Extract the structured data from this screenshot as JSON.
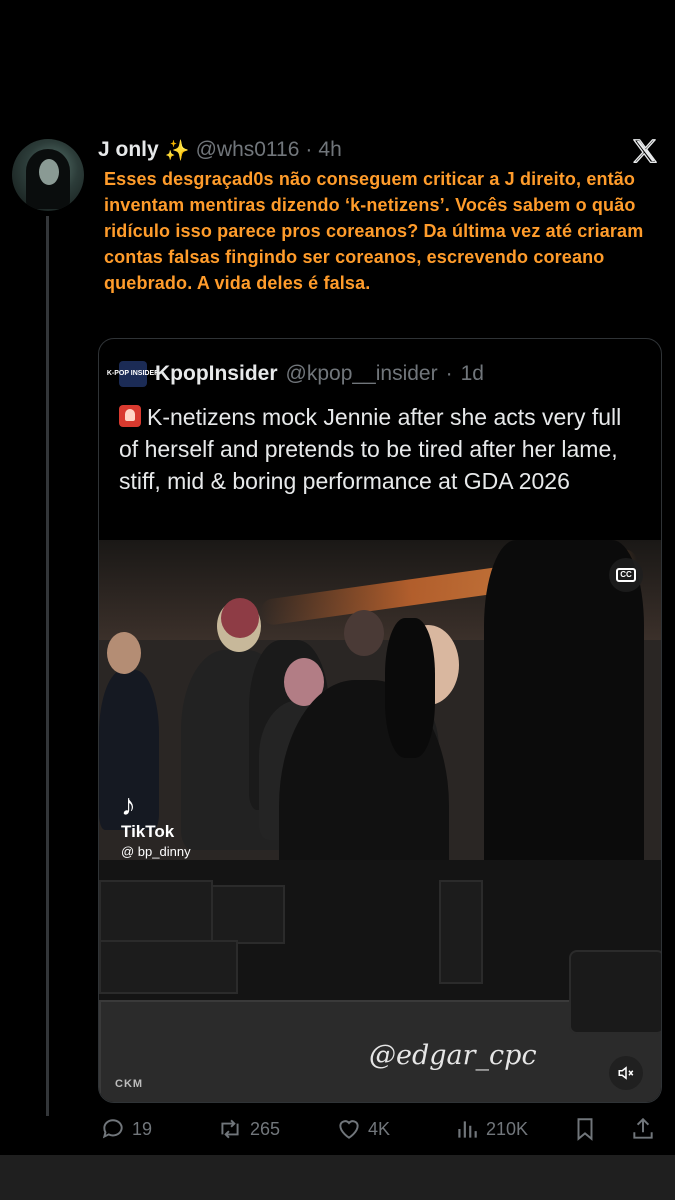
{
  "tweet": {
    "author_name": "J only",
    "author_emoji": "✨",
    "handle": "@whs0116",
    "separator": "·",
    "time": "4h",
    "text": "Esses desgraçad0s não conseguem criticar a J direito, então inventam mentiras dizendo ‘k-netizens’. Vocês sabem o quão ridículo isso parece pros coreanos? Da última vez até criaram contas falsas fingindo ser coreanos, escrevendo coreano quebrado. A vida deles é falsa.",
    "text_color": "#ff9c2b"
  },
  "quote": {
    "logo_text": "K-POP INSIDER",
    "author_name": "KpopInsider",
    "handle": "@kpop__insider",
    "separator": "·",
    "time": "1d",
    "emoji_icon": "police-light-icon",
    "text": "K-netizens mock Jennie after she acts very full of herself and pretends to be tired after her lame, stiff, mid & boring performance at GDA 2026"
  },
  "media": {
    "tiktok_label": "TikTok",
    "tiktok_user": "@ bp_dinny",
    "watermark": "@edgar_cpc",
    "corner_logo": "CKM",
    "cc_label": "CC"
  },
  "actions": {
    "replies": "19",
    "reposts": "265",
    "likes": "4K",
    "views": "210K"
  },
  "colors": {
    "background": "#000000",
    "muted": "#71767b",
    "border": "#2f3336"
  }
}
